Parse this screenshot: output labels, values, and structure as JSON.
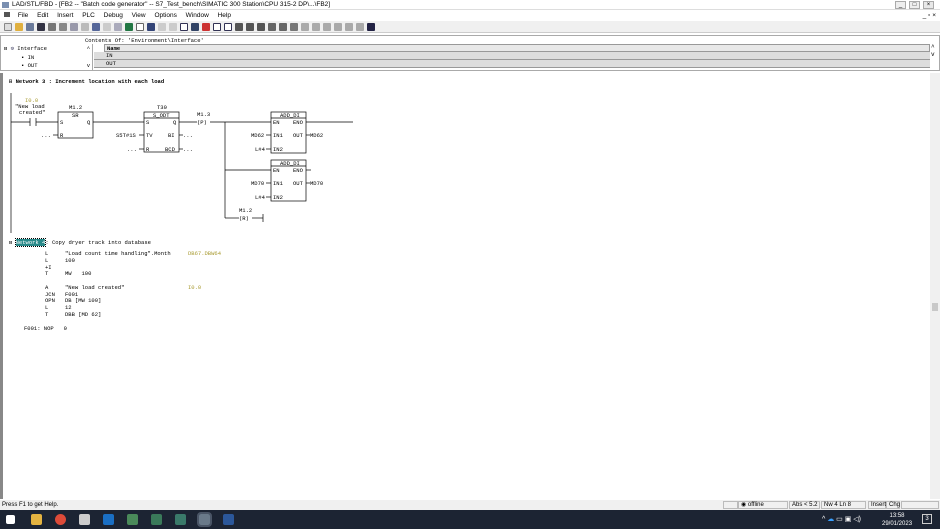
{
  "window": {
    "title": "LAD/STL/FBD  - [FB2 -- \"Batch code generator\" -- S7_Test_bench\\SIMATIC 300 Station\\CPU 315-2 DP\\...\\FB2]"
  },
  "menu": [
    "File",
    "Edit",
    "Insert",
    "PLC",
    "Debug",
    "View",
    "Options",
    "Window",
    "Help"
  ],
  "interface": {
    "contents_of": "Contents Of: 'Environment\\Interface'",
    "tree_root": "Interface",
    "tree_items": [
      "IN",
      "OUT"
    ],
    "column_name": "Name",
    "rows": [
      "IN",
      "OUT"
    ]
  },
  "network3": {
    "title": "Network 3 : Increment location with each load",
    "contact_addr": "I0.0",
    "contact_sym1": "\"New load",
    "contact_sym2": "created\"",
    "sr": {
      "addr": "M1.2",
      "type": "SR",
      "s": "S",
      "q": "Q",
      "r": "R",
      "r_in": "..."
    },
    "timer": {
      "addr": "T30",
      "type": "S_ODT",
      "s": "S",
      "q": "Q",
      "tv": "TV",
      "tv_in": "S5T#1S",
      "bi": "BI",
      "bi_out": "...",
      "r": "R",
      "r_in": "...",
      "bcd": "BCD",
      "bcd_out": "..."
    },
    "coil1": {
      "addr": "M1.3",
      "label": "(P)"
    },
    "add1": {
      "type": "ADD_DI",
      "en": "EN",
      "eno": "ENO",
      "in1": "IN1",
      "in1_val": "MD62",
      "out": "OUT",
      "out_val": "MD62",
      "in2": "IN2",
      "in2_val": "L#4"
    },
    "add2": {
      "type": "ADD_DI",
      "en": "EN",
      "eno": "ENO",
      "in1": "IN1",
      "in1_val": "MD70",
      "out": "OUT",
      "out_val": "MD70",
      "in2": "IN2",
      "in2_val": "L#4"
    },
    "coil2": {
      "addr": "M1.2",
      "label": "(R)"
    }
  },
  "network4": {
    "label": "Network 4",
    "title": ": Copy dryer track into database",
    "lines": [
      {
        "op": "L",
        "arg": "\"Load count time handling\".Month",
        "addr": "DB67.DBW64"
      },
      {
        "op": "L",
        "arg": "100",
        "addr": ""
      },
      {
        "op": "+I",
        "arg": "",
        "addr": ""
      },
      {
        "op": "T",
        "arg": "MW   100",
        "addr": ""
      },
      {
        "op": "A",
        "arg": "\"New load created\"",
        "addr": "I0.0"
      },
      {
        "op": "JCN",
        "arg": "F001",
        "addr": ""
      },
      {
        "op": "OPN",
        "arg": "DB [MW 100]",
        "addr": ""
      },
      {
        "op": "L",
        "arg": "12",
        "addr": ""
      },
      {
        "op": "T",
        "arg": "DBB [MD 62]",
        "addr": ""
      }
    ],
    "label_line": "F001: NOP   0"
  },
  "status": {
    "help": "Press F1 to get Help.",
    "mode": "offline",
    "abs": "Abs < 5.2",
    "pos": "Nw 4  Ln 8",
    "insert": "Insert",
    "chg": "Chg"
  },
  "taskbar": {
    "time": "13:58",
    "date": "29/01/2023",
    "notif": "3"
  }
}
